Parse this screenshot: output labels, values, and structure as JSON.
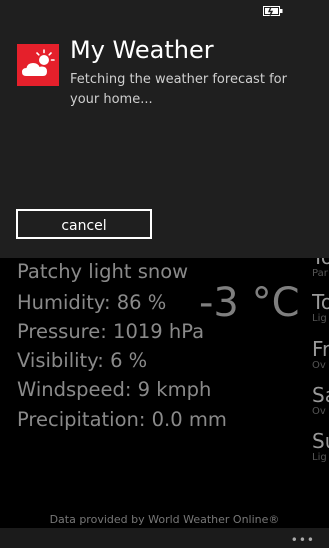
{
  "status_bar": {
    "icons": [
      "battery-charging-icon"
    ]
  },
  "dialog": {
    "app_icon": "weather-sun-cloud-icon",
    "title": "My Weather",
    "message": "Fetching the weather forecast for your home...",
    "cancel_label": "cancel",
    "accent_color": "#e5202b"
  },
  "weather": {
    "condition": "Patchy light snow",
    "humidity": "Humidity:  86 %",
    "pressure": "Pressure:  1019 hPa",
    "visibility": "Visibility:  6 %",
    "windspeed": "Windspeed:  9 kmph",
    "precipitation": "Precipitation:  0.0 mm",
    "temperature": "-3 °C"
  },
  "forecast": [
    {
      "day": "To",
      "summary": "Par"
    },
    {
      "day": "To",
      "summary": "Lig"
    },
    {
      "day": "Fr",
      "summary": "Ov"
    },
    {
      "day": "Sa",
      "summary": "Ov"
    },
    {
      "day": "Su",
      "summary": "Lig"
    }
  ],
  "footer": {
    "credit": "Data provided by World Weather Online®",
    "more_icon": "more-dots-icon"
  }
}
